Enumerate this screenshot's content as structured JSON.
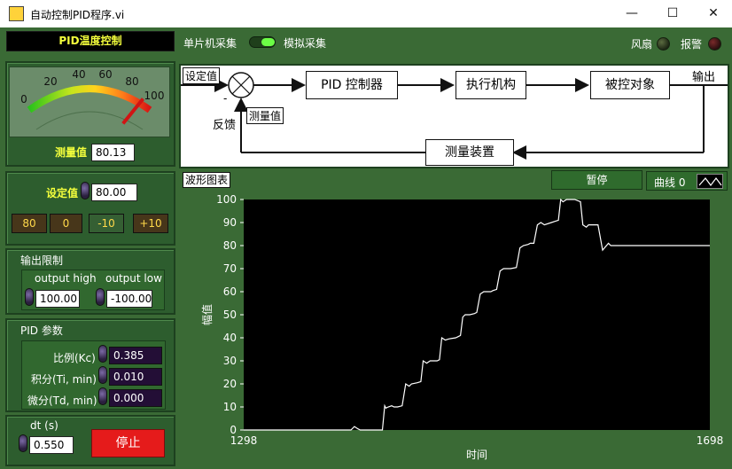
{
  "window": {
    "title": "自动控制PID程序.vi",
    "minimize_glyph": "—",
    "maximize_glyph": "☐",
    "close_glyph": "✕"
  },
  "header": {
    "panel_title": "PID温度控制",
    "source_left": "单片机采集",
    "source_right": "模拟采集",
    "fan_label": "风扇",
    "alarm_label": "报警"
  },
  "gauge": {
    "scale": [
      "0",
      "20",
      "40",
      "60",
      "80",
      "100"
    ],
    "value": 80.13,
    "label": "测量值",
    "display": "80.13"
  },
  "setpoint": {
    "label": "设定值",
    "value": "80.00",
    "buttons": [
      "80",
      "0",
      "-10",
      "+10"
    ]
  },
  "output_limit": {
    "title": "输出限制",
    "high_label": "output high",
    "low_label": "output low",
    "high_value": "100.00",
    "low_value": "-100.00"
  },
  "pid": {
    "title": "PID 参数",
    "kc_label": "比例(Kc)",
    "kc_value": "0.385",
    "ti_label": "积分(Ti, min)",
    "ti_value": "0.010",
    "td_label": "微分(Td, min)",
    "td_value": "0.000"
  },
  "dt": {
    "label": "dt (s)",
    "value": "0.550"
  },
  "stop_label": "停止",
  "diagram": {
    "setpoint_label": "设定值",
    "minus": "-",
    "feedback": "反馈",
    "measured": "测量值",
    "controller": "PID 控制器",
    "actuator": "执行机构",
    "plant": "被控对象",
    "output": "输出",
    "sensor": "测量装置"
  },
  "chart_panel": {
    "title": "波形图表",
    "pause_label": "暂停",
    "curve_label": "曲线 0"
  },
  "chart_data": {
    "type": "line",
    "xlabel": "时间",
    "ylabel": "幅值",
    "xlim": [
      1298,
      1698
    ],
    "ylim": [
      0,
      100
    ],
    "x_ticks": [
      "1298",
      "1698"
    ],
    "y_ticks": [
      "0",
      "10",
      "20",
      "30",
      "40",
      "50",
      "60",
      "70",
      "80",
      "90",
      "100"
    ],
    "series": [
      {
        "line_color": "#ffffff",
        "x": [
          1298,
          1390,
          1393,
          1396,
          1398,
          1401,
          1404,
          1406,
          1409,
          1417,
          1419,
          1420,
          1422,
          1425,
          1427,
          1430,
          1434,
          1437,
          1440,
          1442,
          1447,
          1450,
          1452,
          1455,
          1458,
          1460,
          1464,
          1466,
          1468,
          1471,
          1474,
          1480,
          1482,
          1484,
          1486,
          1488,
          1492,
          1496,
          1498,
          1501,
          1504,
          1507,
          1510,
          1512,
          1515,
          1518,
          1521,
          1524,
          1527,
          1532,
          1535,
          1538,
          1542,
          1544,
          1547,
          1550,
          1553,
          1556,
          1562,
          1565,
          1568,
          1570,
          1572,
          1575,
          1578,
          1582,
          1587,
          1589,
          1592,
          1594,
          1596,
          1599,
          1602,
          1606,
          1611,
          1613,
          1615,
          1618,
          1621,
          1624,
          1630,
          1637,
          1640,
          1643,
          1645,
          1648,
          1651,
          1655,
          1668,
          1671,
          1674,
          1676,
          1679,
          1682,
          1684,
          1688,
          1690,
          1693,
          1698
        ],
        "y": [
          0,
          0,
          1.5,
          0.5,
          0,
          0,
          0,
          0,
          0,
          0,
          10.5,
          9.5,
          10,
          10.5,
          10,
          10,
          10.5,
          20,
          19,
          20,
          20.5,
          21,
          30,
          29,
          30,
          30,
          30,
          30.5,
          40,
          39,
          39.5,
          40,
          40.5,
          41,
          49,
          50,
          50,
          50.5,
          51,
          59,
          60,
          60,
          60,
          60.5,
          61,
          69,
          70,
          70,
          70,
          70.5,
          79,
          80,
          80.5,
          81,
          81,
          89,
          90,
          89,
          90,
          90.5,
          91,
          100,
          99,
          100,
          100,
          100,
          99,
          89,
          88,
          89,
          89,
          89,
          89,
          78,
          81,
          80,
          80,
          80,
          80,
          80,
          80,
          80,
          80,
          80,
          80,
          80,
          80,
          80,
          80,
          80,
          80,
          80,
          80,
          80,
          80,
          80,
          80,
          80,
          80
        ]
      }
    ]
  }
}
